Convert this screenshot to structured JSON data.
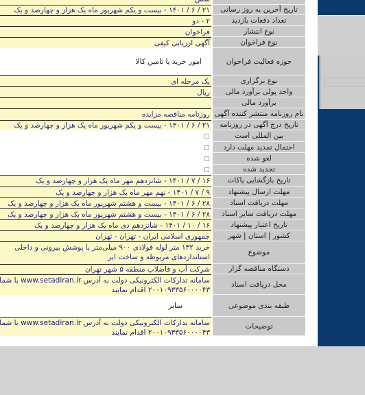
{
  "rows": [
    {
      "label": "",
      "value": "شش",
      "style": "yellow"
    },
    {
      "label": "تاریخ آخرین به روز رسانی",
      "value": "۲۱ / ۶ / ۱۴۰۱ - بیست و یکم شهریور ماه یک هزار و چهارصد و یک"
    },
    {
      "label": "تعداد دفعات بازدید",
      "value": "۲ - دو"
    },
    {
      "label": "نوع انتشار",
      "value": "فراخوان"
    },
    {
      "label": "نوع فراخوان",
      "value": "آگهی ارزیابی کیفی"
    },
    {
      "label": "حوزه فعالیت فراخوان",
      "value": "امور خرید یا تامین کالا"
    },
    {
      "label": "نوع برگزاری",
      "value": "یک مرحله ای"
    },
    {
      "label": "واحد پولی برآورد مالی",
      "value": "ریال"
    },
    {
      "label": "برآورد مالی",
      "value": ""
    },
    {
      "label": "نام روزنامه منتشر کننده آگهی",
      "value": "روزنامه مناقصه مزایده"
    },
    {
      "label": "تاریخ درج آگهی در روزنامه",
      "value": "۲۱ / ۶ / ۱۴۰۱ - بیست و یکم شهریور ماه یک هزار و چهارصد و یک"
    },
    {
      "label": "بین المللی است",
      "checked": false
    },
    {
      "label": "احتمال تمدید مهلت دارد",
      "checked": false
    },
    {
      "label": "لغو شده",
      "checked": false
    },
    {
      "label": "تجدید شده",
      "checked": false
    },
    {
      "label": "تاریخ بازگشایی پاکات",
      "value": "۱۶ / ۷ / ۱۴۰۱ - شانزدهم مهر ماه یک هزار و چهارصد و یک"
    },
    {
      "label": "مهلت ارسال پیشنهاد",
      "value": "۹ / ۷ / ۱۴۰۱ - نهم مهر ماه یک هزار و چهارصد و یک"
    },
    {
      "label": "مهلت دریافت اسناد",
      "value": "۲۸ / ۶ / ۱۴۰۱ - بیست و هشتم شهریور ماه یک هزار و چهارصد و یک"
    },
    {
      "label": "مهلت دریافت سایر اسناد",
      "value": "۲۸ / ۶ / ۱۴۰۱ - بیست و هشتم شهریور ماه یک هزار و چهارصد و یک"
    },
    {
      "label": "تاریخ اعتبار پیشنهاد",
      "value": "۱۶ / ۱۰ / ۱۴۰۱ - شانزدهم دی ماه یک هزار و چهارصد و یک"
    },
    {
      "label": "کشور | استان | شهر",
      "value": "جمهوری اسلامی ایران - تهران - تهران"
    },
    {
      "label": "موضوع",
      "lines": [
        "خرید ۱۳۲ متر لوله فولادی ۹۰۰ میلی‌متر با پوشش بیرونی و داخلی",
        "استانداردهای مربوطه و ساخت ایر"
      ]
    },
    {
      "label": "دستگاه مناقصه گزار",
      "value": "شرکت آب و فاضلاب منطقه ۵ شهر تهران"
    },
    {
      "label": "محل دریافت اسناد",
      "lines": [
        "سامانه تدارکات الکترونیکی دولت به آدرس www.setadiran.ir با شماره",
        "۲۰۰۱۰۹۳۳۵۶۰۰۰۰۴۳ اقدام نمایند"
      ]
    },
    {
      "label": "طبقه بندی موضوعی",
      "value": "سایر"
    },
    {
      "label": "توضیحات",
      "lines": [
        "سامانه تدارکات الکترونیکی دولت به آدرس www.setadiran.ir با شماره",
        "۲۰۰۱۰۹۳۳۵۶۰۰۰۰۴۳ اقدام نمایند"
      ]
    }
  ],
  "colors": {
    "label_bg": "#c9c9c9",
    "value_bg": "#fdf9c6",
    "value_text": "#22228a",
    "side_panel": "#0b3a6e"
  }
}
